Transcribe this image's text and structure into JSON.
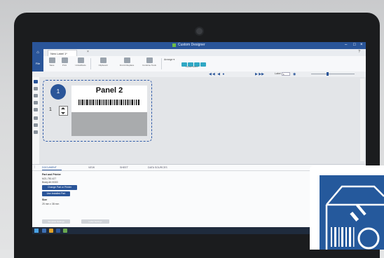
{
  "window": {
    "app_title": "Custom Designer"
  },
  "tabs": {
    "document_tab": "New Label 1*",
    "close_glyph": "×"
  },
  "ribbon": {
    "file": "File",
    "buttons": [
      "Save",
      "Print",
      "Undo/Redo",
      "Clipboard",
      "Find & Replace",
      "Combine Tools"
    ],
    "arrange": "Arrange ▾",
    "layout_label": "Layout Editor"
  },
  "subbar": {
    "label_caption": "Label",
    "label_value": "1"
  },
  "canvas": {
    "panel_number": "1",
    "panel_title": "Panel 2",
    "quantity": "1"
  },
  "props": {
    "tabs": [
      "DOCUMENT",
      "VIEW",
      "SHEET",
      "DATA SOURCES"
    ],
    "section_part": "Part and Printer",
    "part_number": "M21-750-427",
    "printer": "BradyJet i5300",
    "btn_change": "Change Part or Printer",
    "btn_installed": "Use Installed Part",
    "section_size": "Size",
    "size_value": "25 mm x 38 mm",
    "gray_btn_1": "Template Settings",
    "gray_btn_2": "Label Settings"
  },
  "colors": {
    "brand_blue": "#2a5599",
    "accent_teal": "#2fa8c4",
    "dashed_frame": "#2f5aa8"
  }
}
